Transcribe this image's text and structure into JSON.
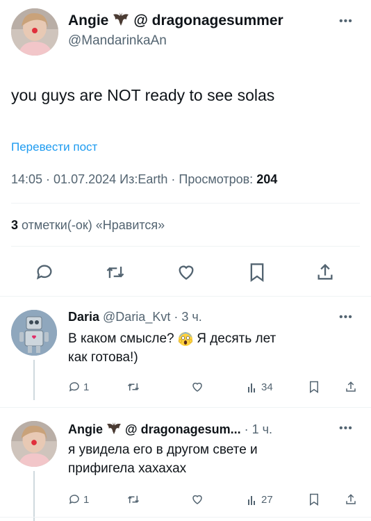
{
  "main_tweet": {
    "display_name": "Angie",
    "name_suffix": "@ dragonagesummer",
    "handle": "@MandarinkaAn",
    "more_icon": "more-dots-icon",
    "text": "you guys are NOT ready to see solas",
    "translate_label": "Перевести пост",
    "time": "14:05 · 01.07.2024",
    "source": "Из:Earth",
    "views_label": "Просмотров:",
    "views_count": "204",
    "likes_count": "3",
    "likes_label": "отметки(-ок) «Нравится»"
  },
  "actions": {
    "reply_icon": "reply-icon",
    "retweet_icon": "retweet-icon",
    "like_icon": "heart-icon",
    "bookmark_icon": "bookmark-icon",
    "share_icon": "share-icon"
  },
  "replies": [
    {
      "display_name": "Daria",
      "handle": "@Daria_Kvt",
      "time": "· 3 ч.",
      "text_line1": "В каком смысле?",
      "text_line1_end": "Я десять лет",
      "text_line2": "как готова!)",
      "emoji": "scream-emoji",
      "reply_count": "1",
      "retweet_count": "",
      "like_count": "",
      "view_count": "34"
    },
    {
      "display_name": "Angie",
      "name_suffix": "@ dragonagesum...",
      "time": "· 1 ч.",
      "text_line1": "я увидела его в другом свете и",
      "text_line2": "прифигела хахахах",
      "reply_count": "1",
      "retweet_count": "",
      "like_count": "",
      "view_count": "27"
    }
  ],
  "colors": {
    "accent": "#1d9bf0",
    "text": "#0f1419",
    "secondary": "#536471",
    "divider": "#eff3f4"
  }
}
